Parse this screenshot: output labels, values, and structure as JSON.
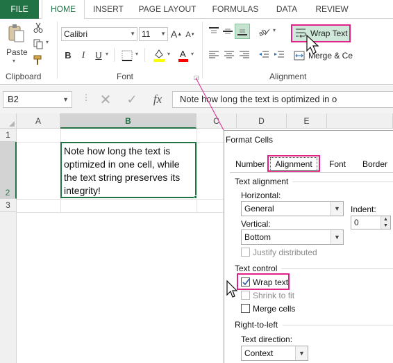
{
  "ribbon_tabs": [
    "FILE",
    "HOME",
    "INSERT",
    "PAGE LAYOUT",
    "FORMULAS",
    "DATA",
    "REVIEW"
  ],
  "clipboard": {
    "paste_label": "Paste",
    "group_label": "Clipboard"
  },
  "font": {
    "name": "Calibri",
    "size": "11",
    "bold": "B",
    "italic": "I",
    "underline": "U",
    "grow": "A",
    "shrink": "A",
    "group_label": "Font"
  },
  "alignment": {
    "wrap_text": "Wrap Text",
    "merge_center": "Merge & Ce",
    "group_label": "Alignment"
  },
  "formula_bar": {
    "name_box": "B2",
    "fx": "fx",
    "content": "Note how long the text is optimized in o"
  },
  "sheet": {
    "columns": [
      "A",
      "B",
      "C",
      "D",
      "E"
    ],
    "rows": [
      "1",
      "2",
      "3"
    ],
    "cell_b2": "Note how long the text is optimized in one cell, while the text string preserves its integrity!"
  },
  "dialog": {
    "title": "Format Cells",
    "tabs": [
      "Number",
      "Alignment",
      "Font",
      "Border"
    ],
    "text_alignment_label": "Text alignment",
    "horizontal_label": "Horizontal:",
    "horizontal_value": "General",
    "indent_label": "Indent:",
    "indent_value": "0",
    "vertical_label": "Vertical:",
    "vertical_value": "Bottom",
    "justify_distributed": "Justify distributed",
    "text_control_label": "Text control",
    "wrap_text": "Wrap text",
    "shrink_to_fit": "Shrink to fit",
    "merge_cells": "Merge cells",
    "rtl_label": "Right-to-left",
    "text_direction_label": "Text direction:",
    "text_direction_value": "Context"
  },
  "colors": {
    "excel_green": "#217346",
    "highlight": "#e0218a",
    "wrap_btn_fill": "#cfe8d9"
  }
}
